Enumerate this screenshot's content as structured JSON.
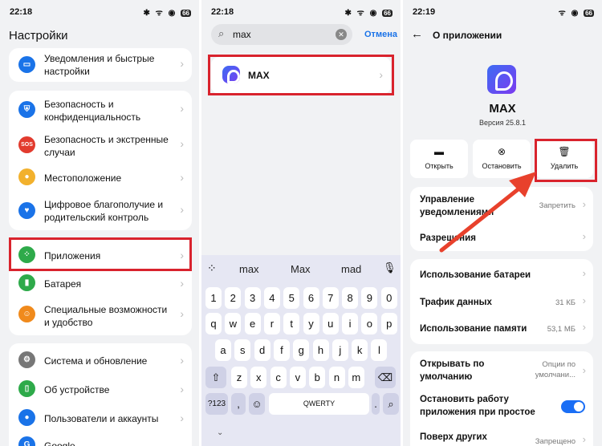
{
  "panel1": {
    "time": "22:18",
    "battery": "66",
    "title": "Настройки",
    "items": [
      {
        "label": "Уведомления и быстрые настройки"
      },
      {
        "label": "Безопасность и конфиденциальность"
      },
      {
        "label": "Безопасность и экстренные случаи",
        "badge": "SOS"
      },
      {
        "label": "Местоположение"
      },
      {
        "label": "Цифровое благополучие и родительский контроль"
      },
      {
        "label": "Приложения"
      },
      {
        "label": "Батарея"
      },
      {
        "label": "Специальные возможности и удобство"
      },
      {
        "label": "Система и обновление"
      },
      {
        "label": "Об устройстве"
      },
      {
        "label": "Пользователи и аккаунты"
      },
      {
        "label": "Google"
      }
    ]
  },
  "panel2": {
    "time": "22:18",
    "battery": "66",
    "search_query": "max",
    "cancel_label": "Отмена",
    "result_label": "MAX",
    "suggestions": [
      "max",
      "Max",
      "mad"
    ],
    "row1": [
      "1",
      "2",
      "3",
      "4",
      "5",
      "6",
      "7",
      "8",
      "9",
      "0"
    ],
    "row2": [
      "q",
      "w",
      "e",
      "r",
      "t",
      "y",
      "u",
      "i",
      "o",
      "p"
    ],
    "row3": [
      "a",
      "s",
      "d",
      "f",
      "g",
      "h",
      "j",
      "k",
      "l"
    ],
    "row4": [
      "z",
      "x",
      "c",
      "v",
      "b",
      "n",
      "m"
    ],
    "sym_key": "?123",
    "comma_key": ",",
    "space_label": "QWERTY",
    "dot_key": "."
  },
  "panel3": {
    "time": "22:19",
    "battery": "66",
    "header": "О приложении",
    "app_name": "MAX",
    "version": "Версия 25.8.1",
    "actions": [
      "Открыть",
      "Остановить",
      "Удалить"
    ],
    "notif_label": "Управление уведомлениями",
    "notif_value": "Запретить",
    "perm_label": "Разрешения",
    "battery_label": "Использование батареи",
    "traffic_label": "Трафик данных",
    "traffic_value": "31 КБ",
    "memory_label": "Использование памяти",
    "memory_value": "53,1 МБ",
    "default_label": "Открывать по умолчанию",
    "default_value": "Опции по умолчани...",
    "stop_label": "Остановить работу приложения при простое",
    "overlay_label": "Поверх других",
    "overlay_value": "Запрещено"
  },
  "colors": {
    "highlight": "#d9232d",
    "accent": "#1a73e8",
    "toggle": "#1a6ef5"
  }
}
